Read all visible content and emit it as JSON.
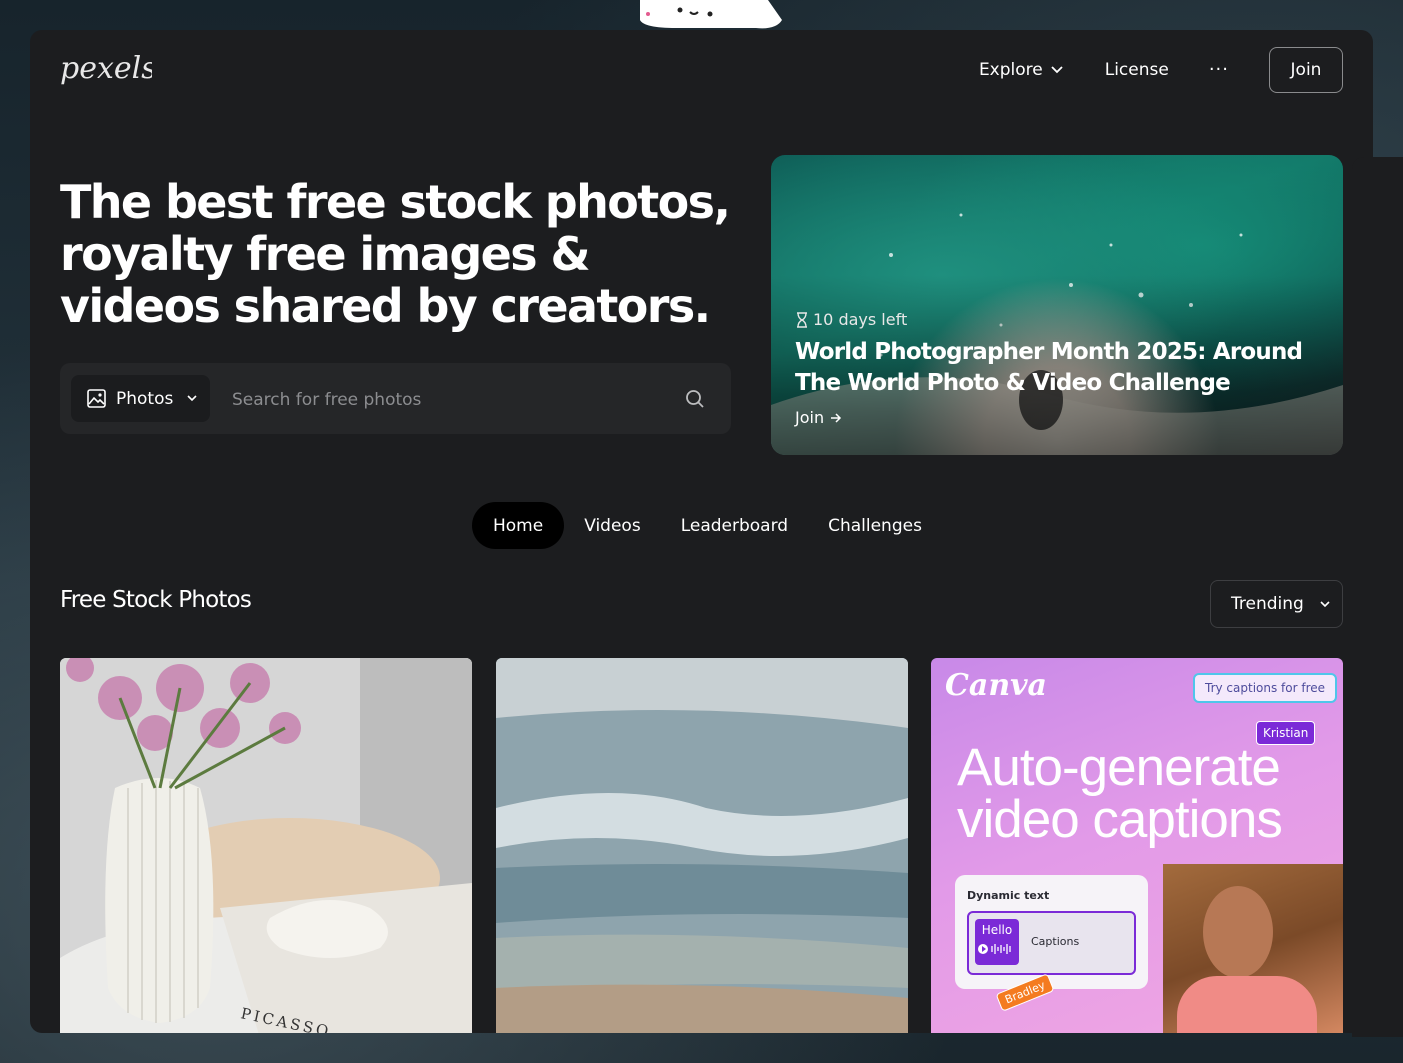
{
  "nav": {
    "logo_text": "pexels",
    "explore_label": "Explore",
    "license_label": "License",
    "more_label": "···",
    "join_label": "Join"
  },
  "hero": {
    "title": "The best free stock photos, royalty free images & videos shared by creators."
  },
  "search": {
    "type_label": "Photos",
    "placeholder": "Search for free photos"
  },
  "banner": {
    "days_left": "10 days left",
    "title": "World Photographer Month 2025: Around The World Photo & Video Challenge",
    "join_label": "Join"
  },
  "tabs": [
    {
      "label": "Home",
      "active": true
    },
    {
      "label": "Videos",
      "active": false
    },
    {
      "label": "Leaderboard",
      "active": false
    },
    {
      "label": "Challenges",
      "active": false
    }
  ],
  "section": {
    "title": "Free Stock Photos",
    "sort_label": "Trending"
  },
  "ad": {
    "brand": "Canva",
    "cta": "Try captions for free",
    "name_tag": "Kristian",
    "headline": "Auto-generate video captions",
    "card_title": "Dynamic text",
    "hello_label": "Hello",
    "captions_label": "Captions",
    "bradley_tag": "Bradley"
  },
  "photo_text": {
    "book_title": "PICASSO"
  },
  "colors": {
    "window_bg": "#1c1d1f",
    "search_bg": "#252628",
    "tab_active_bg": "#000000",
    "canva_purple": "#7b2ad7",
    "canva_pink": "#e29ae8"
  }
}
